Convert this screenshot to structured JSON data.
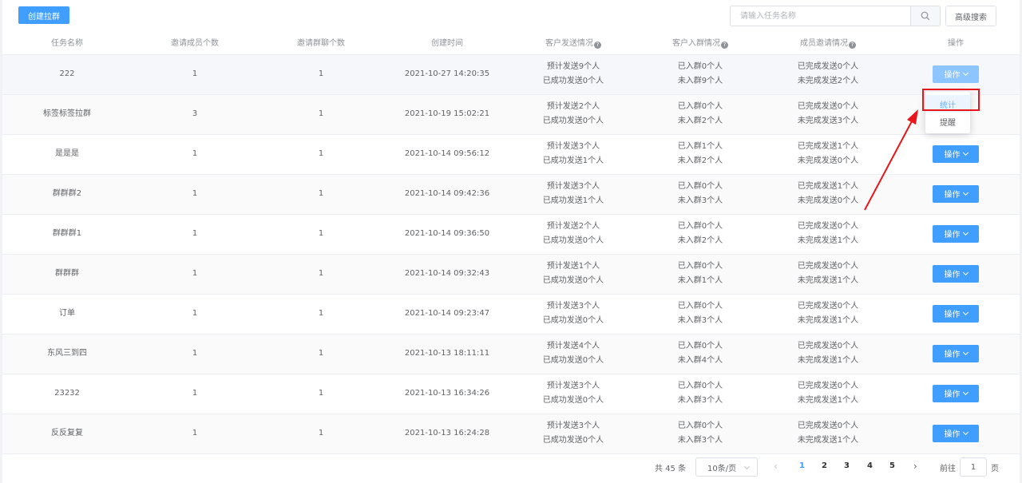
{
  "toolbar": {
    "create_label": "创建拉群",
    "search_placeholder": "请输入任务名称",
    "adv_search_label": "高级搜索"
  },
  "table": {
    "headers": [
      "任务名称",
      "邀请成员个数",
      "邀请群聊个数",
      "创建时间",
      "客户发送情况",
      "客户入群情况",
      "成员邀请情况",
      "操作"
    ],
    "op_label": "操作",
    "rows": [
      {
        "name": "222",
        "members": "1",
        "groups": "1",
        "time": "2021-10-27 14:20:35",
        "send1": "预计发送9个人",
        "send2": "已成功发送0个人",
        "join1": "已入群0个人",
        "join2": "未入群9个人",
        "inv1": "已完成发送0个人",
        "inv2": "未完成发送2个人"
      },
      {
        "name": "标签标签拉群",
        "members": "3",
        "groups": "1",
        "time": "2021-10-19 15:02:21",
        "send1": "预计发送2个人",
        "send2": "已成功发送0个人",
        "join1": "已入群0个人",
        "join2": "未入群2个人",
        "inv1": "已完成发送0个人",
        "inv2": "未完成发送3个人"
      },
      {
        "name": "是是是",
        "members": "1",
        "groups": "1",
        "time": "2021-10-14 09:56:12",
        "send1": "预计发送3个人",
        "send2": "已成功发送1个人",
        "join1": "已入群1个人",
        "join2": "未入群2个人",
        "inv1": "已完成发送1个人",
        "inv2": "未完成发送0个人"
      },
      {
        "name": "群群群2",
        "members": "1",
        "groups": "1",
        "time": "2021-10-14 09:42:36",
        "send1": "预计发送3个人",
        "send2": "已成功发送1个人",
        "join1": "已入群0个人",
        "join2": "未入群3个人",
        "inv1": "已完成发送1个人",
        "inv2": "未完成发送0个人"
      },
      {
        "name": "群群群1",
        "members": "1",
        "groups": "1",
        "time": "2021-10-14 09:36:50",
        "send1": "预计发送2个人",
        "send2": "已成功发送0个人",
        "join1": "已入群0个人",
        "join2": "未入群2个人",
        "inv1": "已完成发送0个人",
        "inv2": "未完成发送1个人"
      },
      {
        "name": "群群群",
        "members": "1",
        "groups": "1",
        "time": "2021-10-14 09:32:43",
        "send1": "预计发送1个人",
        "send2": "已成功发送0个人",
        "join1": "已入群0个人",
        "join2": "未入群1个人",
        "inv1": "已完成发送0个人",
        "inv2": "未完成发送1个人"
      },
      {
        "name": "订单",
        "members": "1",
        "groups": "1",
        "time": "2021-10-14 09:23:47",
        "send1": "预计发送3个人",
        "send2": "已成功发送0个人",
        "join1": "已入群0个人",
        "join2": "未入群3个人",
        "inv1": "已完成发送0个人",
        "inv2": "未完成发送1个人"
      },
      {
        "name": "东风三到四",
        "members": "1",
        "groups": "1",
        "time": "2021-10-13 18:11:11",
        "send1": "预计发送4个人",
        "send2": "已成功发送0个人",
        "join1": "已入群0个人",
        "join2": "未入群4个人",
        "inv1": "已完成发送0个人",
        "inv2": "未完成发送1个人"
      },
      {
        "name": "23232",
        "members": "1",
        "groups": "1",
        "time": "2021-10-13 16:34:26",
        "send1": "预计发送3个人",
        "send2": "已成功发送0个人",
        "join1": "已入群0个人",
        "join2": "未入群3个人",
        "inv1": "已完成发送0个人",
        "inv2": "未完成发送1个人"
      },
      {
        "name": "反反复复",
        "members": "1",
        "groups": "1",
        "time": "2021-10-13 16:24:28",
        "send1": "预计发送3个人",
        "send2": "已成功发送0个人",
        "join1": "已入群0个人",
        "join2": "未入群3个人",
        "inv1": "已完成发送0个人",
        "inv2": "未完成发送1个人"
      }
    ]
  },
  "dropdown": {
    "items": [
      "统计",
      "提醒"
    ]
  },
  "pagination": {
    "total": "共 45 条",
    "page_size": "10条/页",
    "pages": [
      "1",
      "2",
      "3",
      "4",
      "5"
    ],
    "current": "1",
    "goto_label": "前往",
    "goto_value": "1",
    "unit": "页"
  },
  "colors": {
    "primary": "#409eff",
    "highlight": "#e8151a"
  }
}
